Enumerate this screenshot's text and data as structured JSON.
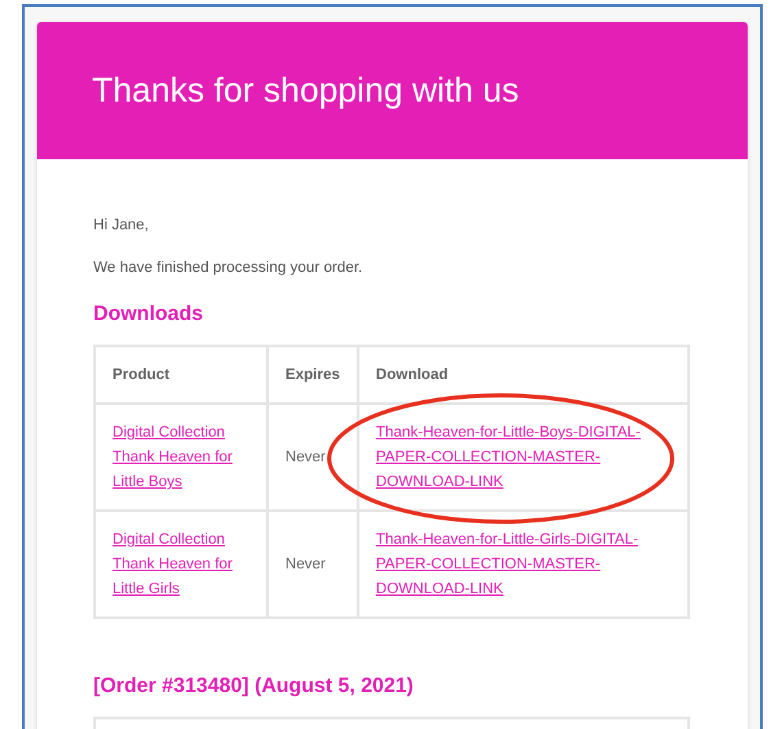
{
  "header": {
    "title": "Thanks for shopping with us"
  },
  "greeting": "Hi Jane,",
  "message": "We have finished processing your order.",
  "downloads": {
    "heading": "Downloads",
    "columns": [
      "Product",
      "Expires",
      "Download"
    ],
    "rows": [
      {
        "product": "Digital Collection Thank Heaven for Little Boys",
        "expires": "Never",
        "download": "Thank-Heaven-for-Little-Boys-DIGITAL-PAPER-COLLECTION-MASTER-DOWNLOAD-LINK",
        "circled": true
      },
      {
        "product": "Digital Collection Thank Heaven for Little Girls",
        "expires": "Never",
        "download": "Thank-Heaven-for-Little-Girls-DIGITAL-PAPER-COLLECTION-MASTER-DOWNLOAD-LINK",
        "circled": false
      }
    ]
  },
  "order_heading": "[Order #313480] (August 5, 2021)"
}
